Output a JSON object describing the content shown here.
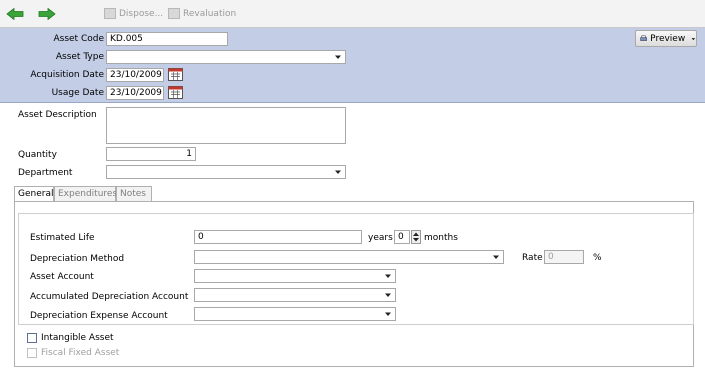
{
  "toolbar": {
    "back_icon": "green-left-arrow",
    "forward_icon": "green-right-arrow",
    "dispose_label": "Dispose...",
    "revaluation_label": "Revaluation"
  },
  "header": {
    "asset_code_label": "Asset Code",
    "asset_code_value": "KD.005",
    "asset_type_label": "Asset Type",
    "asset_type_value": "",
    "acquisition_date_label": "Acquisition Date",
    "acquisition_date_value": "23/10/2009",
    "usage_date_label": "Usage Date",
    "usage_date_value": "23/10/2009",
    "preview_label": "Preview"
  },
  "form": {
    "asset_description_label": "Asset Description",
    "asset_description_value": "",
    "quantity_label": "Quantity",
    "quantity_value": "1",
    "department_label": "Department",
    "department_value": ""
  },
  "tabs": [
    {
      "label": "General"
    },
    {
      "label": "Expenditures"
    },
    {
      "label": "Notes"
    }
  ],
  "general": {
    "estimated_life_label": "Estimated Life",
    "estimated_life_value": "0",
    "years_label": "years",
    "months_value": "0",
    "months_label": "months",
    "depreciation_method_label": "Depreciation Method",
    "depreciation_method_value": "",
    "rate_label": "Rate",
    "rate_value": "0",
    "rate_unit": "%",
    "asset_account_label": "Asset Account",
    "accumulated_depreciation_label": "Accumulated Depreciation Account",
    "depreciation_expense_label": "Depreciation Expense Account",
    "intangible_asset_label": "Intangible Asset",
    "fiscal_fixed_asset_label": "Fiscal Fixed Asset"
  },
  "colors": {
    "header_bg": "#c3cee6",
    "arrow_green": "#3aa43a"
  }
}
